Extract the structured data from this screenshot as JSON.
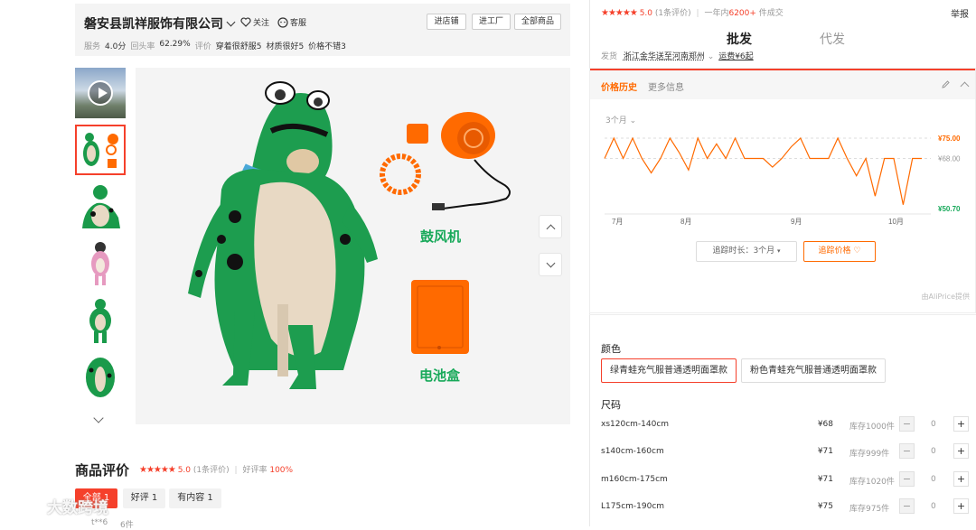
{
  "store": {
    "name": "磐安县凯祥服饰有限公司",
    "follow": "关注",
    "service": "客服",
    "buttons": [
      "进店铺",
      "进工厂",
      "全部商品"
    ],
    "stats": {
      "service_label": "服务",
      "service_value": "4.0分",
      "repurchase_label": "回头率",
      "repurchase_value": "62.29%",
      "review_label": "评价",
      "tags": [
        "穿着很舒服5",
        "材质很好5",
        "价格不错3"
      ]
    }
  },
  "gallery": {
    "labels": {
      "blower": "鼓风机",
      "battery": "电池盒"
    }
  },
  "reviews": {
    "title": "商品评价",
    "score": "5.0",
    "count": "(1条评价)",
    "sep": "|",
    "good_rate_label": "好评率",
    "good_rate": "100%",
    "filters": [
      "全部 1",
      "好评 1",
      "有内容 1"
    ],
    "reviewer": "t**6",
    "reviewer_meta": "6件"
  },
  "watermark": "大数跨境",
  "right": {
    "score": "5.0",
    "count": "(1条评价)",
    "sep": "|",
    "sold_prefix": "一年内",
    "sold_value": "6200+",
    "sold_suffix": "件成交",
    "report": "举报",
    "tabs": [
      "批发",
      "代发"
    ],
    "ship_label": "发货",
    "ship_value": "浙江金华送至河南郑州",
    "freight": "运费¥6起"
  },
  "price_history": {
    "tab_active": "价格历史",
    "tab_other": "更多信息",
    "range": "3个月",
    "track_label": "追踪时长：3个月",
    "track_button": "追踪价格",
    "provider": "由AliPrice提供",
    "chart_data": {
      "type": "line",
      "x_ticks": [
        "7月",
        "8月",
        "9月",
        "10月"
      ],
      "y_labels": [
        "¥75.00",
        "¥68.00",
        "¥50.70"
      ],
      "ylim": [
        50.7,
        75
      ],
      "max": 75,
      "min": 50.7,
      "avg": 68,
      "values": [
        68,
        75,
        68,
        75,
        68,
        63,
        68,
        75,
        70,
        64,
        75,
        68,
        73,
        68,
        75,
        68,
        68,
        68,
        65,
        68,
        72,
        75,
        68,
        68,
        68,
        75,
        68,
        62,
        68,
        55,
        68,
        68,
        52,
        68,
        68
      ]
    }
  },
  "sku": {
    "color_label": "颜色",
    "colors": [
      "绿青蛙充气服普通透明面罩款",
      "粉色青蛙充气服普通透明面罩款"
    ],
    "size_label": "尺码",
    "rows": [
      {
        "name": "xs120cm-140cm",
        "price": "¥68",
        "stock": "库存1000件",
        "qty": "0"
      },
      {
        "name": "s140cm-160cm",
        "price": "¥71",
        "stock": "库存999件",
        "qty": "0"
      },
      {
        "name": "m160cm-175cm",
        "price": "¥71",
        "stock": "库存1020件",
        "qty": "0"
      },
      {
        "name": "L175cm-190cm",
        "price": "¥75",
        "stock": "库存975件",
        "qty": "0"
      }
    ],
    "minus": "−",
    "plus": "+"
  },
  "colors": {
    "accent": "#f5402b",
    "orange": "#ff6a00",
    "green": "#18a95a"
  }
}
